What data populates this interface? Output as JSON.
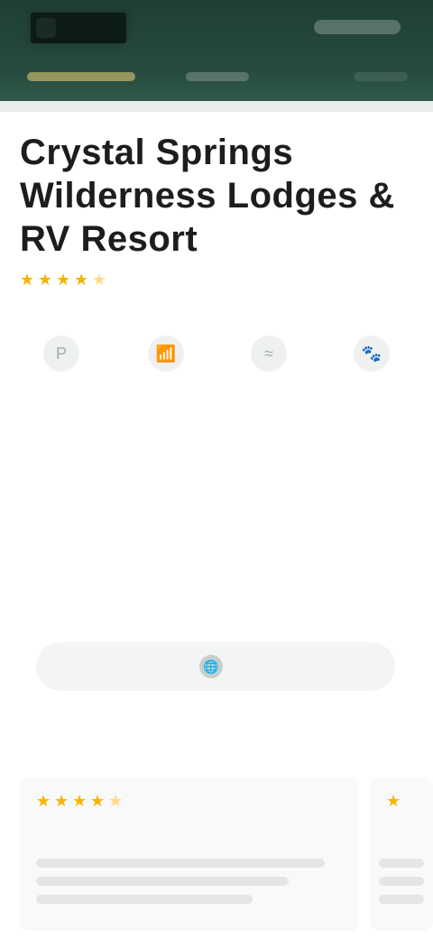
{
  "header": {
    "logo_text": "",
    "link": "",
    "tabs": [
      "",
      "",
      ""
    ]
  },
  "page": {
    "title": "Crystal Springs Wilderness Lodges & RV Resort",
    "rating_filled": 4.5,
    "rating_max": 5
  },
  "amenities": [
    {
      "label": "",
      "icon": "parking-icon"
    },
    {
      "label": "",
      "icon": "wifi-icon"
    },
    {
      "label": "",
      "icon": "pool-icon"
    },
    {
      "label": "",
      "icon": "pet-icon"
    }
  ],
  "address": {
    "heading": "",
    "maplink": "",
    "line1": "",
    "line2": "",
    "line3": ""
  },
  "phone": {
    "heading": "",
    "number": ""
  },
  "cta": {
    "label": ""
  },
  "reviews": {
    "heading_left": "",
    "heading_right": "",
    "card1_title": "",
    "card2_title": ""
  }
}
